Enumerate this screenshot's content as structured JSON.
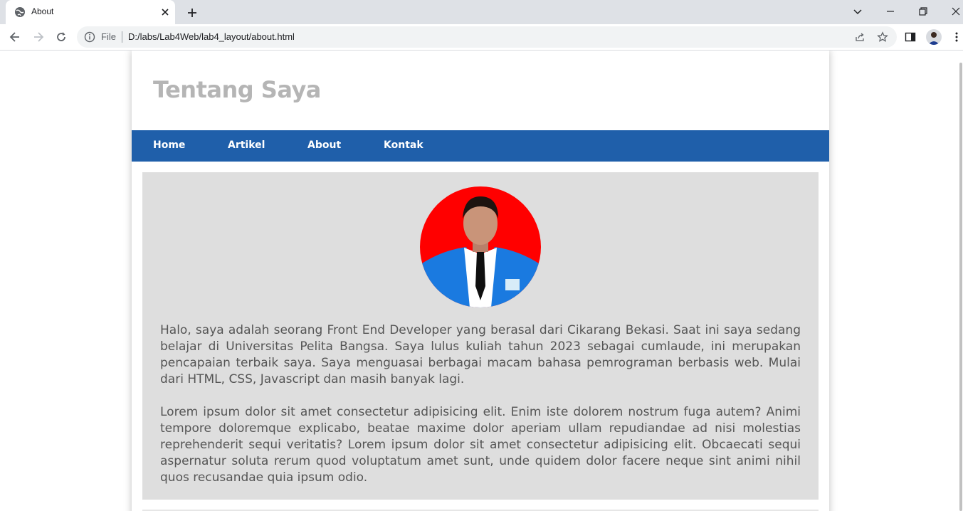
{
  "browser": {
    "tab_title": "About",
    "omnibox_file_label": "File",
    "url": "D:/labs/Lab4Web/lab4_layout/about.html"
  },
  "page": {
    "site_title": "Tentang Saya",
    "nav": [
      {
        "label": "Home"
      },
      {
        "label": "Artikel"
      },
      {
        "label": "About"
      },
      {
        "label": "Kontak"
      }
    ],
    "paragraphs": [
      "Halo, saya adalah seorang Front End Developer yang berasal dari Cikarang Bekasi. Saat ini saya sedang belajar di Universitas Pelita Bangsa. Saya lulus kuliah tahun 2023 sebagai cumlaude, ini merupakan pencapaian terbaik saya. Saya menguasai berbagai macam bahasa pemrograman berbasis web. Mulai dari HTML, CSS, Javascript dan masih banyak lagi.",
      "Lorem ipsum dolor sit amet consectetur adipisicing elit. Enim iste dolorem nostrum fuga autem? Animi tempore doloremque explicabo, beatae maxime dolor aperiam ullam repudiandae ad nisi molestias reprehenderit sequi veritatis? Lorem ipsum dolor sit amet consectetur adipisicing elit. Obcaecati sequi aspernatur soluta rerum quod voluptatum amet sunt, unde quidem dolor facere neque sint animi nihil quos recusandae quia ipsum odio."
    ]
  },
  "colors": {
    "nav_bg": "#1f5faa",
    "content_bg": "#dedede",
    "title_color": "#b5b5b5",
    "text_color": "#555555"
  }
}
